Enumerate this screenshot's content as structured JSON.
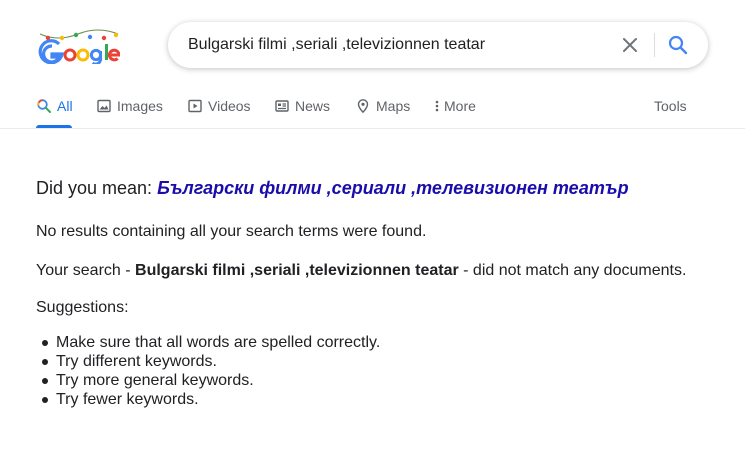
{
  "header": {
    "logo_text": "Google",
    "search": {
      "value": "Bulgarski filmi ,seriali ,televizionnen teatar"
    }
  },
  "tabs": [
    {
      "label": "All",
      "icon": "search-icon",
      "active": true
    },
    {
      "label": "Images",
      "icon": "image-icon"
    },
    {
      "label": "Videos",
      "icon": "video-icon"
    },
    {
      "label": "News",
      "icon": "news-icon"
    },
    {
      "label": "Maps",
      "icon": "map-pin-icon"
    },
    {
      "label": "More",
      "icon": "more-vert-icon"
    }
  ],
  "tools_label": "Tools",
  "results": {
    "did_you_mean_label": "Did you mean:",
    "did_you_mean_suggestion": "Български филми ,сериали ,телевизионен театър",
    "no_results": "No results containing all your search terms were found.",
    "your_search_prefix": "Your search -",
    "your_search_query": "Bulgarski filmi ,seriali ,televizionnen teatar",
    "your_search_suffix": "- did not match any documents.",
    "suggestions_heading": "Suggestions:",
    "suggestions": [
      "Make sure that all words are spelled correctly.",
      "Try different keywords.",
      "Try more general keywords.",
      "Try fewer keywords."
    ]
  },
  "colors": {
    "accent": "#1a73e8",
    "link": "#1a0dab",
    "text": "#202124",
    "muted": "#5f6368"
  }
}
